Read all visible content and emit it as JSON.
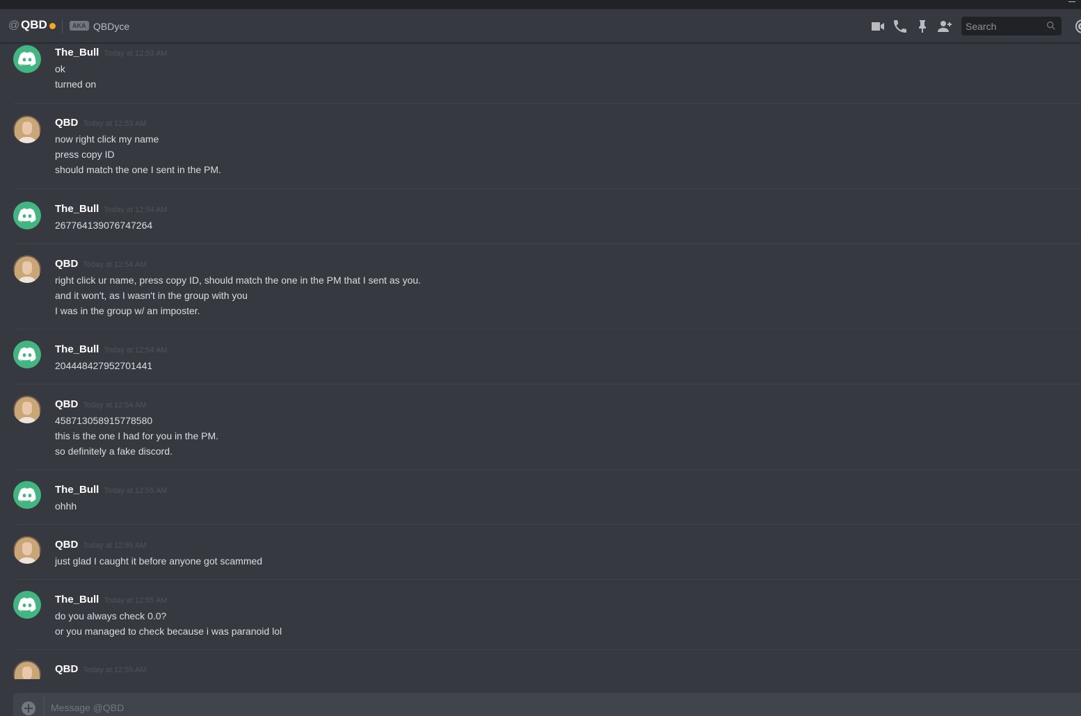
{
  "header": {
    "at_symbol": "@",
    "username": "QBD",
    "status_color": "#faa61a",
    "aka_badge": "AKA",
    "alias": "QBDyce",
    "search_placeholder": "Search",
    "icons": [
      "video-call-icon",
      "voice-call-icon",
      "pin-icon",
      "add-friend-icon",
      "search-icon",
      "mention-icon"
    ]
  },
  "messages": [
    {
      "author": "The_Bull",
      "avatar": "discord-default",
      "timestamp": "Today at 12:53 AM",
      "lines": [
        "ok",
        "turned on"
      ]
    },
    {
      "author": "QBD",
      "avatar": "photo",
      "timestamp": "Today at 12:53 AM",
      "lines": [
        "now right click my name",
        "press copy ID",
        "should match the one I sent in the PM."
      ]
    },
    {
      "author": "The_Bull",
      "avatar": "discord-default",
      "timestamp": "Today at 12:54 AM",
      "lines": [
        "267764139076747264"
      ]
    },
    {
      "author": "QBD",
      "avatar": "photo",
      "timestamp": "Today at 12:54 AM",
      "lines": [
        "right click ur name, press copy ID, should match the one in the PM that I sent as you.",
        "and it won't, as I wasn't in the group with you",
        "I was in the group w/ an imposter."
      ]
    },
    {
      "author": "The_Bull",
      "avatar": "discord-default",
      "timestamp": "Today at 12:54 AM",
      "lines": [
        "204448427952701441"
      ]
    },
    {
      "author": "QBD",
      "avatar": "photo",
      "timestamp": "Today at 12:54 AM",
      "lines": [
        "458713058915778580",
        "this is the one I had for you in the PM.",
        "so definitely a fake discord."
      ]
    },
    {
      "author": "The_Bull",
      "avatar": "discord-default",
      "timestamp": "Today at 12:55 AM",
      "lines": [
        "ohhh"
      ]
    },
    {
      "author": "QBD",
      "avatar": "photo",
      "timestamp": "Today at 12:55 AM",
      "lines": [
        "just glad I caught it before anyone got scammed"
      ]
    },
    {
      "author": "The_Bull",
      "avatar": "discord-default",
      "timestamp": "Today at 12:55 AM",
      "lines": [
        "do you always check 0.0?",
        "or you managed to check because i was paranoid lol"
      ]
    },
    {
      "author": "QBD",
      "avatar": "photo",
      "timestamp": "Today at 12:55 AM",
      "lines": []
    }
  ],
  "composer": {
    "placeholder": "Message @QBD"
  },
  "colors": {
    "background": "#36393f",
    "discord_default_avatar": "#43b581",
    "idle_status": "#faa61a"
  }
}
